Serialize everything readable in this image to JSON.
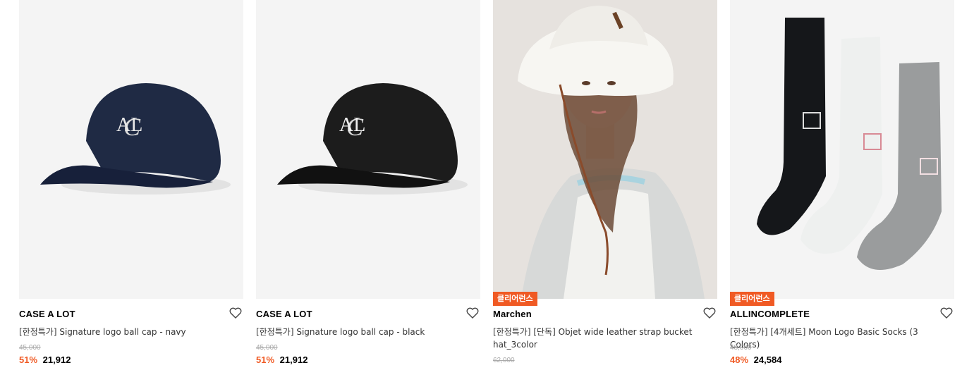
{
  "products": [
    {
      "brand": "CASE A LOT",
      "name": "[한정특가] Signature logo ball cap - navy",
      "original_price": "45,000",
      "discount": "51%",
      "price": "21,912",
      "badge": "",
      "image": "navy-ball-cap-photo",
      "liked": false
    },
    {
      "brand": "CASE A LOT",
      "name": "[한정특가] Signature logo ball cap - black",
      "original_price": "45,000",
      "discount": "51%",
      "price": "21,912",
      "badge": "",
      "image": "black-ball-cap-photo",
      "liked": false
    },
    {
      "brand": "Marchen",
      "name": "[한정특가] [단독] Objet wide leather strap bucket hat_3color",
      "original_price": "62,000",
      "discount": "",
      "price": "",
      "badge": "클리어런스",
      "image": "model-bucket-hat-photo",
      "liked": false
    },
    {
      "brand": "ALLINCOMPLETE",
      "name": "[한정특가] [4개세트] Moon Logo Basic Socks (3 Colors)",
      "original_price": "48,000",
      "discount": "48%",
      "price": "24,584",
      "badge": "클리어런스",
      "image": "socks-set-photo",
      "liked": false
    }
  ],
  "colors": {
    "accent": "#f05a24",
    "placeholder_bg": "#f4f4f4"
  }
}
